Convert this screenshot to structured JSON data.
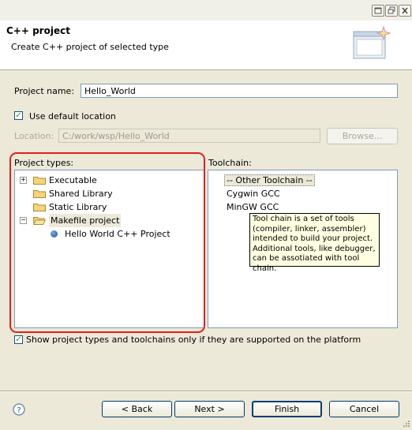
{
  "header": {
    "title": "C++ project",
    "description": "Create C++ project of selected type"
  },
  "form": {
    "project_name_label": "Project name:",
    "project_name_value": "Hello_World",
    "use_default_location_label": "Use default location",
    "use_default_location_checked": true,
    "location_label": "Location:",
    "location_value": "C:/work/wsp/Hello_World",
    "browse_label": "Browse..."
  },
  "project_types": {
    "label": "Project types:",
    "items": [
      {
        "label": "Executable",
        "icon": "folder-icon",
        "expander": "+"
      },
      {
        "label": "Shared Library",
        "icon": "folder-icon"
      },
      {
        "label": "Static Library",
        "icon": "folder-icon"
      },
      {
        "label": "Makefile project",
        "icon": "open-folder-icon",
        "expander": "−"
      },
      {
        "label": "Hello World C++ Project",
        "icon": "project-bullet-icon"
      }
    ]
  },
  "toolchain": {
    "label": "Toolchain:",
    "items": [
      "-- Other Toolchain --",
      "Cygwin GCC",
      "MinGW GCC"
    ],
    "tooltip_lines": [
      "Tool chain is a set of tools",
      "(compiler, linker, assembler)",
      "intended to build your project.",
      "Additional tools, like debugger,",
      "can be assotiated with tool chain."
    ]
  },
  "filter": {
    "label": "Show project types and toolchains only if they are supported on the platform",
    "checked": true
  },
  "buttons": {
    "back": "< Back",
    "next": "Next >",
    "finish": "Finish",
    "cancel": "Cancel"
  },
  "colors": {
    "dialog_bg": "#ece9d8",
    "highlight_red": "#e02020",
    "tooltip_bg": "#ffffe1"
  }
}
